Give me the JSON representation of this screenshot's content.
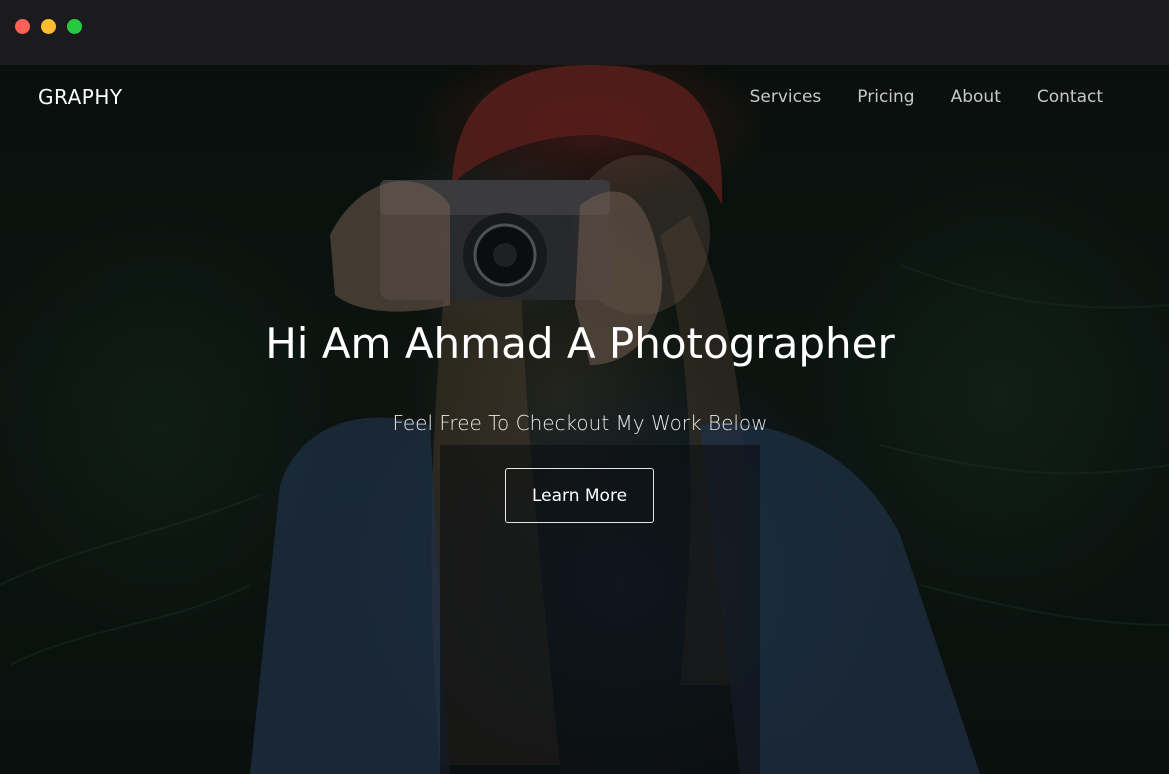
{
  "window": {
    "controls": [
      "close",
      "minimize",
      "maximize"
    ],
    "colors": {
      "close": "#fe5f57",
      "minimize": "#febc2e",
      "maximize": "#28c840"
    }
  },
  "header": {
    "logo": "GRAPHY",
    "nav": [
      {
        "label": "Services"
      },
      {
        "label": "Pricing"
      },
      {
        "label": "About"
      },
      {
        "label": "Contact"
      }
    ]
  },
  "hero": {
    "title": "Hi Am Ahmad A Photographer",
    "subtitle": "Feel Free To Checkout My Work Below",
    "cta_label": "Learn More"
  },
  "colors": {
    "titlebar": "#1b1b1d",
    "text": "#ffffff",
    "nav_text": "#c8c8c8"
  }
}
